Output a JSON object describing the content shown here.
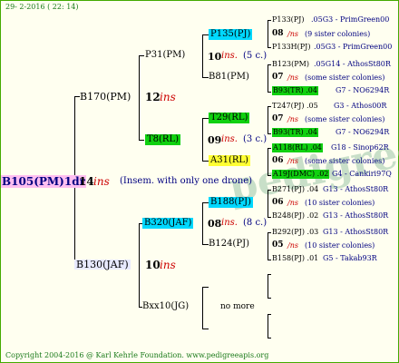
{
  "header_date": "29-  2-2016 ( 22: 14)",
  "footer": "Copyright 2004-2016 @ Karl Kehrle Foundation.   www.pedigreeapis.org",
  "root": {
    "id": "B105(PM)1dr",
    "num": "14",
    "ins": "ins",
    "note": "(Insem. with only one drone)"
  },
  "gen1": [
    {
      "id": "B170(PM)",
      "num": "12",
      "ins": "ins"
    },
    {
      "id": "B130(JAF)",
      "num": "10",
      "ins": "ins"
    }
  ],
  "gen2": [
    {
      "id": "P31(PM)",
      "num": "10",
      "ins": "ins.",
      "sc": "(5 c.)"
    },
    {
      "id": "B81(PM)"
    },
    {
      "id": "T8(RL)",
      "num": "09",
      "ins": "ins.",
      "sc": "(3 c.)"
    },
    {
      "id": "A31(RL)"
    },
    {
      "id": "B320(JAF)",
      "num": "08",
      "ins": "ins.",
      "sc": "(8 c.)"
    },
    {
      "id": "B124(PJ)"
    },
    {
      "id": "Bxx10(JG)",
      "nomore": "no more"
    }
  ],
  "gen3": [
    {
      "id": "P135(PJ)"
    },
    {
      "id": "B81(PM)"
    },
    {
      "id": "T29(RL)"
    },
    {
      "id": "A31(RL)"
    },
    {
      "id": "B188(PJ)"
    },
    {
      "id": "B124(PJ)"
    }
  ],
  "gen4": [
    {
      "id": "P133(PJ)",
      "code": ".05G3 - PrimGreen00"
    },
    {
      "n": "08",
      "ins": "/ns",
      "sis": "(9 sister colonies)"
    },
    {
      "id": "P133H(PJ)",
      "code": ".05G3 - PrimGreen00"
    },
    {
      "id": "B123(PM)",
      "code": ".05G14 - AthosSt80R"
    },
    {
      "n": "07",
      "ins": "/ns",
      "sis": "(some sister colonies)"
    },
    {
      "id": "B93(TR) .04",
      "code": "G7 - NO6294R"
    },
    {
      "id": "T247(PJ) .05",
      "code": "G3 - Athos00R"
    },
    {
      "n": "07",
      "ins": "/ns",
      "sis": "(some sister colonies)"
    },
    {
      "id": "B93(TR) .04",
      "code": "G7 - NO6294R"
    },
    {
      "id": "A118(RL) .04",
      "code": "G18 - Sinop62R"
    },
    {
      "n": "06",
      "ins": "/ns",
      "sis": "(some sister colonies)"
    },
    {
      "id": "A19J(DMC) .02",
      "code": "G4 - Cankiri97Q"
    },
    {
      "id": "B271(PJ) .04",
      "code": "G13 - AthosSt80R"
    },
    {
      "n": "06",
      "ins": "/ns",
      "sis": "(10 sister colonies)"
    },
    {
      "id": "B248(PJ) .02",
      "code": "G13 - AthosSt80R"
    },
    {
      "id": "B292(PJ) .03",
      "code": "G13 - AthosSt80R"
    },
    {
      "n": "05",
      "ins": "/ns",
      "sis": "(10 sister colonies)"
    },
    {
      "id": "B158(PJ) .01",
      "code": "G5 - Takab93R"
    }
  ],
  "watermark": "pedigreeapis",
  "colors": {
    "cyan": "#00d8ff",
    "green": "#10d010",
    "yellow": "#ffff33",
    "pink": "#ffbff0",
    "red": "#cc0000",
    "navy": "#000080",
    "copyright": "#1a7a1a"
  }
}
